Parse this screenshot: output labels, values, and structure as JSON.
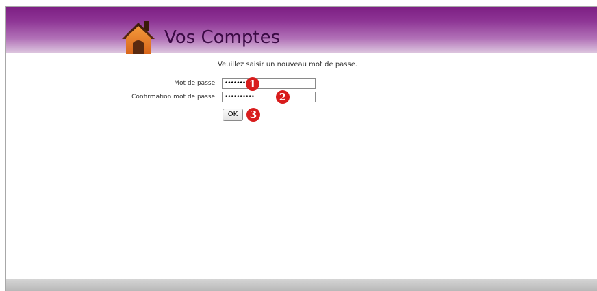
{
  "header": {
    "logo_icon": "house-icon",
    "title": "Vos Comptes",
    "gradient_colors": [
      "#7d1f84",
      "#dcc4de"
    ]
  },
  "form": {
    "instruction": "Veuillez saisir un nouveau mot de passe.",
    "password_label": "Mot de passe :",
    "password_value": "••••••••••",
    "confirm_label": "Confirmation mot de passe :",
    "confirm_value": "••••••••••",
    "ok_label": "OK"
  },
  "markers": [
    {
      "label": "1",
      "icon": "numbered-circle-icon",
      "color": "#d81c1c"
    },
    {
      "label": "2",
      "icon": "numbered-circle-icon",
      "color": "#d81c1c"
    },
    {
      "label": "3",
      "icon": "numbered-circle-icon",
      "color": "#d81c1c"
    }
  ]
}
